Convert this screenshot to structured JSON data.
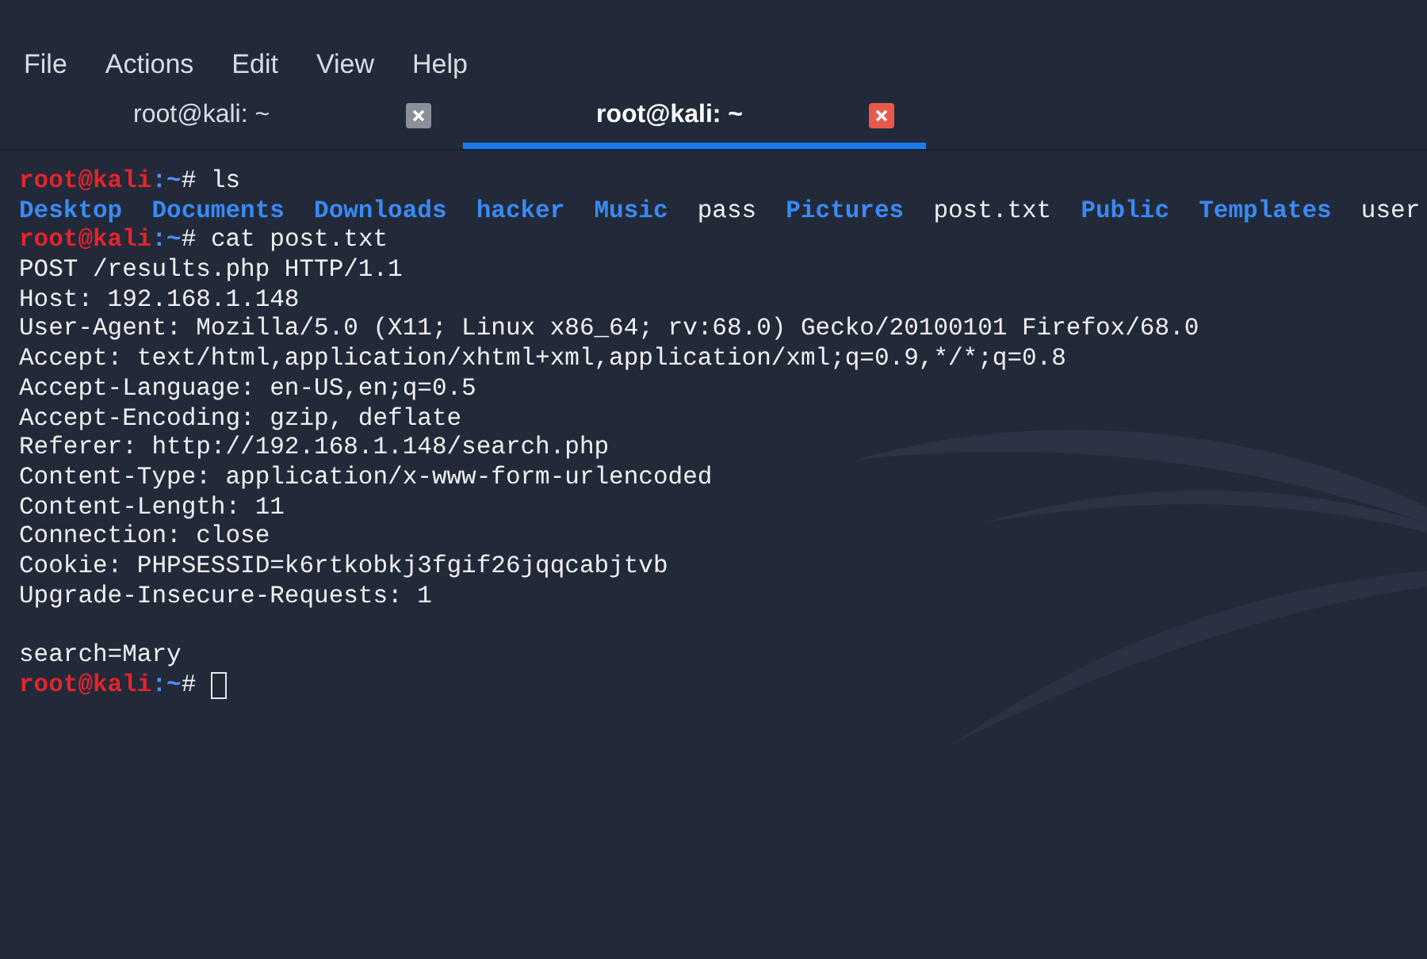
{
  "menu": [
    "File",
    "Actions",
    "Edit",
    "View",
    "Help"
  ],
  "tabs": [
    {
      "label": "root@kali: ~",
      "selected": false
    },
    {
      "label": "root@kali: ~",
      "selected": true
    }
  ],
  "terminal": {
    "lines": [
      {
        "kind": "prompt",
        "user": "root@kali",
        "sep": ":",
        "path": "~",
        "symbol": "#",
        "command": "ls"
      },
      {
        "kind": "listing",
        "entries": [
          {
            "name": "Desktop",
            "kind": "dir"
          },
          {
            "name": "Documents",
            "kind": "dir"
          },
          {
            "name": "Downloads",
            "kind": "dir"
          },
          {
            "name": "hacker",
            "kind": "dir"
          },
          {
            "name": "Music",
            "kind": "dir"
          },
          {
            "name": "pass",
            "kind": "file"
          },
          {
            "name": "Pictures",
            "kind": "dir"
          },
          {
            "name": "post.txt",
            "kind": "file"
          },
          {
            "name": "Public",
            "kind": "dir"
          },
          {
            "name": "Templates",
            "kind": "dir"
          },
          {
            "name": "user",
            "kind": "file"
          }
        ]
      },
      {
        "kind": "prompt",
        "user": "root@kali",
        "sep": ":",
        "path": "~",
        "symbol": "#",
        "command": "cat post.txt"
      },
      {
        "kind": "text",
        "text": "POST /results.php HTTP/1.1"
      },
      {
        "kind": "text",
        "text": "Host: 192.168.1.148"
      },
      {
        "kind": "text",
        "text": "User-Agent: Mozilla/5.0 (X11; Linux x86_64; rv:68.0) Gecko/20100101 Firefox/68.0"
      },
      {
        "kind": "text",
        "text": "Accept: text/html,application/xhtml+xml,application/xml;q=0.9,*/*;q=0.8"
      },
      {
        "kind": "text",
        "text": "Accept-Language: en-US,en;q=0.5"
      },
      {
        "kind": "text",
        "text": "Accept-Encoding: gzip, deflate"
      },
      {
        "kind": "text",
        "text": "Referer: http://192.168.1.148/search.php"
      },
      {
        "kind": "text",
        "text": "Content-Type: application/x-www-form-urlencoded"
      },
      {
        "kind": "text",
        "text": "Content-Length: 11"
      },
      {
        "kind": "text",
        "text": "Connection: close"
      },
      {
        "kind": "text",
        "text": "Cookie: PHPSESSID=k6rtkobkj3fgif26jqqcabjtvb"
      },
      {
        "kind": "text",
        "text": "Upgrade-Insecure-Requests: 1"
      },
      {
        "kind": "blank"
      },
      {
        "kind": "text",
        "text": "search=Mary"
      },
      {
        "kind": "prompt",
        "user": "root@kali",
        "sep": ":",
        "path": "~",
        "symbol": "#",
        "cursor": true
      }
    ]
  }
}
